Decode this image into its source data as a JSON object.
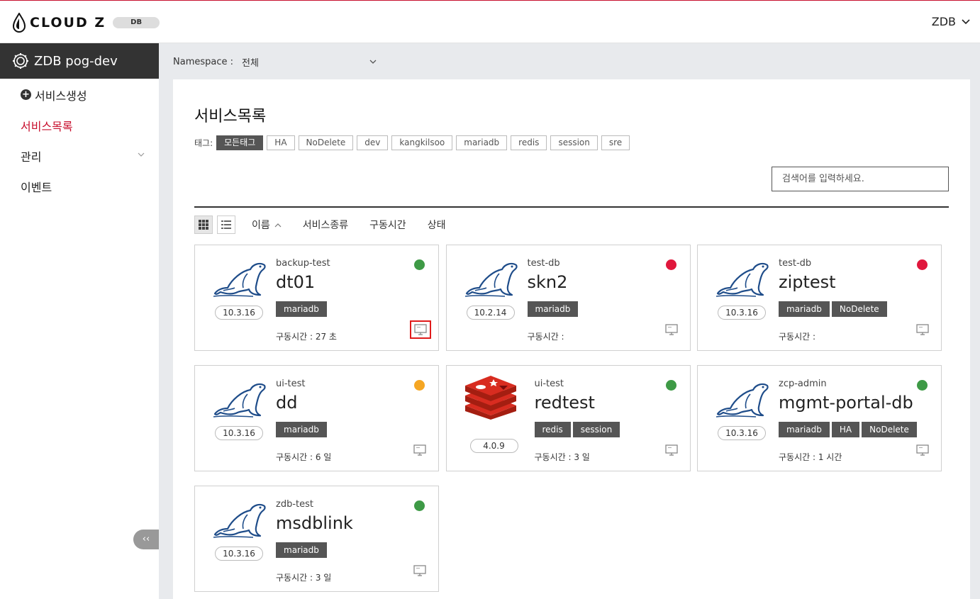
{
  "app": {
    "logo_text": "CLOUD Z",
    "logo_badge": "DB",
    "user_name": "ZDB"
  },
  "sidebar": {
    "namespace_title": "ZDB pog-dev",
    "items": [
      {
        "label": "서비스생성"
      },
      {
        "label": "서비스목록"
      },
      {
        "label": "관리"
      },
      {
        "label": "이벤트"
      }
    ],
    "collapse_label": "‹‹"
  },
  "namespace": {
    "label": "Namespace :",
    "value": "전체"
  },
  "main": {
    "title": "서비스목록",
    "tags_label": "태그:",
    "tag_filters": [
      "모든태그",
      "HA",
      "NoDelete",
      "dev",
      "kangkilsoo",
      "mariadb",
      "redis",
      "session",
      "sre"
    ],
    "search_placeholder": "검색어를 입력하세요.",
    "sort_columns": [
      "이름",
      "서비스종류",
      "구동시간",
      "상태"
    ]
  },
  "colors": {
    "accent": "#c8102e",
    "status_green": "#3e9a46",
    "status_red": "#e0173c",
    "status_orange": "#f5a623",
    "mariadb_blue": "#1f4d8a",
    "redis_red": "#d82c20"
  },
  "services": [
    {
      "group": "backup-test",
      "name": "dt01",
      "version": "10.3.16",
      "type": "mariadb-icon",
      "tags": [
        "mariadb"
      ],
      "uptime": "구동시간 : 27 초",
      "status": "green",
      "monitor_highlight": true
    },
    {
      "group": "test-db",
      "name": "skn2",
      "version": "10.2.14",
      "type": "mariadb-icon",
      "tags": [
        "mariadb"
      ],
      "uptime": "구동시간 :",
      "status": "red",
      "monitor_highlight": false
    },
    {
      "group": "test-db",
      "name": "ziptest",
      "version": "10.3.16",
      "type": "mariadb-icon",
      "tags": [
        "mariadb",
        "NoDelete"
      ],
      "uptime": "구동시간 :",
      "status": "red",
      "monitor_highlight": false
    },
    {
      "group": "ui-test",
      "name": "dd",
      "version": "10.3.16",
      "type": "mariadb-icon",
      "tags": [
        "mariadb"
      ],
      "uptime": "구동시간 : 6 일",
      "status": "orange",
      "monitor_highlight": false
    },
    {
      "group": "ui-test",
      "name": "redtest",
      "version": "4.0.9",
      "type": "redis-icon",
      "tags": [
        "redis",
        "session"
      ],
      "uptime": "구동시간 : 3 일",
      "status": "green",
      "monitor_highlight": false
    },
    {
      "group": "zcp-admin",
      "name": "mgmt-portal-db",
      "version": "10.3.16",
      "type": "mariadb-icon",
      "tags": [
        "mariadb",
        "HA",
        "NoDelete"
      ],
      "uptime": "구동시간 : 1 시간",
      "status": "green",
      "monitor_highlight": false
    },
    {
      "group": "zdb-test",
      "name": "msdblink",
      "version": "10.3.16",
      "type": "mariadb-icon",
      "tags": [
        "mariadb"
      ],
      "uptime": "구동시간 : 3 일",
      "status": "green",
      "monitor_highlight": false
    }
  ]
}
